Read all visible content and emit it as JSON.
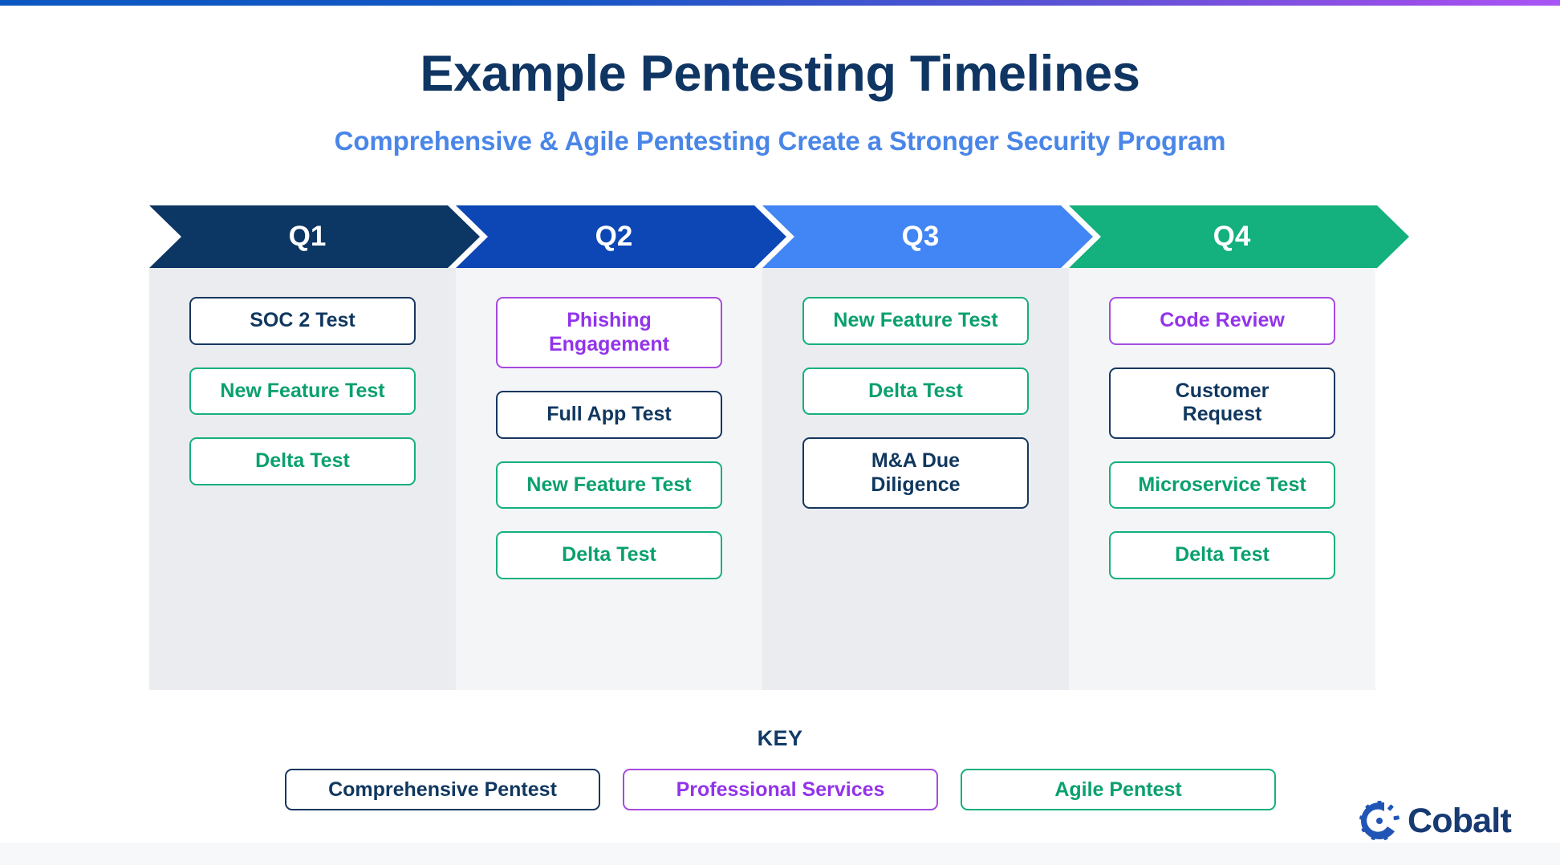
{
  "header": {
    "title": "Example Pentesting Timelines",
    "subtitle": "Comprehensive & Agile Pentesting Create a Stronger Security Program"
  },
  "colors": {
    "title_navy": "#0f3563",
    "subtitle_blue": "#4a86e8",
    "q1": "#0c3663",
    "q2": "#0d47b5",
    "q3": "#4285f4",
    "q4": "#14b07e",
    "comprehensive_navy": "#10375f",
    "professional_purple": "#9333ea",
    "agile_green": "#0aa06e",
    "accent_bar_start": "#0b57c2",
    "accent_bar_end": "#a855f7"
  },
  "timeline": {
    "quarters": [
      {
        "label": "Q1",
        "color": "#0c3663",
        "items": [
          {
            "label": "SOC 2 Test",
            "category": "comprehensive"
          },
          {
            "label": "New Feature Test",
            "category": "agile"
          },
          {
            "label": "Delta Test",
            "category": "agile"
          }
        ]
      },
      {
        "label": "Q2",
        "color": "#0d47b5",
        "items": [
          {
            "label": "Phishing\nEngagement",
            "category": "professional"
          },
          {
            "label": "Full App Test",
            "category": "comprehensive"
          },
          {
            "label": "New Feature Test",
            "category": "agile"
          },
          {
            "label": "Delta Test",
            "category": "agile"
          }
        ]
      },
      {
        "label": "Q3",
        "color": "#4285f4",
        "items": [
          {
            "label": "New Feature Test",
            "category": "agile"
          },
          {
            "label": "Delta Test",
            "category": "agile"
          },
          {
            "label": "M&A Due\nDiligence",
            "category": "comprehensive"
          }
        ]
      },
      {
        "label": "Q4",
        "color": "#14b07e",
        "items": [
          {
            "label": "Code Review",
            "category": "professional"
          },
          {
            "label": "Customer\nRequest",
            "category": "comprehensive"
          },
          {
            "label": "Microservice Test",
            "category": "agile"
          },
          {
            "label": "Delta Test",
            "category": "agile"
          }
        ]
      }
    ]
  },
  "key": {
    "label": "KEY",
    "items": [
      {
        "label": "Comprehensive Pentest",
        "category": "comprehensive"
      },
      {
        "label": "Professional Services",
        "category": "professional"
      },
      {
        "label": "Agile Pentest",
        "category": "agile"
      }
    ]
  },
  "logo": {
    "wordmark": "Cobalt",
    "icon": "cobalt-gear-icon"
  }
}
